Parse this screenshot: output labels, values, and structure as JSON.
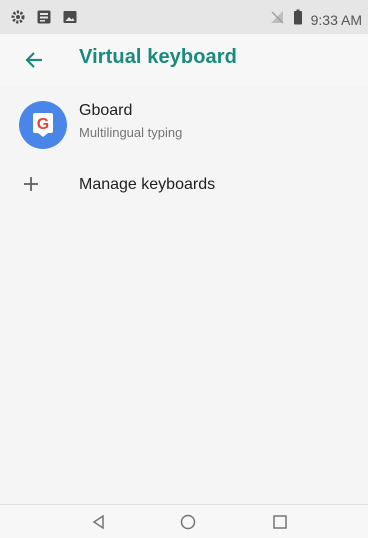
{
  "status_bar": {
    "time": "9:33 AM",
    "left_icons": [
      "settings-icon",
      "sim-card-icon",
      "image-icon"
    ],
    "right_icons": [
      "no-signal-icon",
      "battery-icon"
    ]
  },
  "app_bar": {
    "title": "Virtual keyboard",
    "back_icon": "arrow-left-icon",
    "accent_color": "#1a8a7e"
  },
  "keyboards": [
    {
      "name": "Gboard",
      "subtitle": "Multilingual typing",
      "icon": "gboard-icon",
      "icon_color": "#4a86e8"
    }
  ],
  "manage": {
    "label": "Manage keyboards",
    "icon": "plus-icon"
  },
  "nav_bar": {
    "buttons": [
      "back-triangle-icon",
      "home-circle-icon",
      "recents-square-icon"
    ]
  }
}
